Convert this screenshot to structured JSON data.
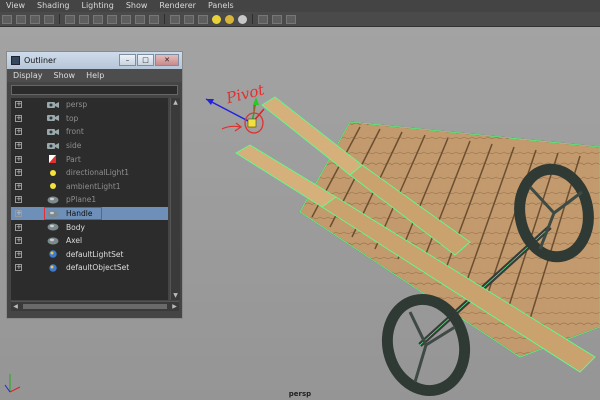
{
  "menubar": {
    "items": [
      "View",
      "Shading",
      "Lighting",
      "Show",
      "Renderer",
      "Panels"
    ]
  },
  "viewport": {
    "camera_label": "persp",
    "annotation": "Pivot"
  },
  "outliner": {
    "title": "Outliner",
    "menu": [
      "Display",
      "Show",
      "Help"
    ],
    "filter_value": "",
    "window_buttons": [
      "–",
      "□",
      "✕"
    ],
    "items": [
      {
        "label": "persp",
        "icon": "camera-icon",
        "dim": true,
        "selected": false
      },
      {
        "label": "top",
        "icon": "camera-icon",
        "dim": true,
        "selected": false
      },
      {
        "label": "front",
        "icon": "camera-icon",
        "dim": true,
        "selected": false
      },
      {
        "label": "side",
        "icon": "camera-icon",
        "dim": true,
        "selected": false
      },
      {
        "label": "Part",
        "icon": "part-icon",
        "dim": true,
        "selected": false
      },
      {
        "label": "directionalLight1",
        "icon": "light-icon",
        "dim": true,
        "selected": false
      },
      {
        "label": "ambientLight1",
        "icon": "light-icon",
        "dim": true,
        "selected": false
      },
      {
        "label": "pPlane1",
        "icon": "mesh-icon",
        "dim": true,
        "selected": false
      },
      {
        "label": "Handle",
        "icon": "mesh-icon",
        "dim": false,
        "selected": true
      },
      {
        "label": "Body",
        "icon": "mesh-icon",
        "dim": false,
        "selected": false
      },
      {
        "label": "Axel",
        "icon": "mesh-icon",
        "dim": false,
        "selected": false
      },
      {
        "label": "defaultLightSet",
        "icon": "set-icon",
        "dim": false,
        "selected": false
      },
      {
        "label": "defaultObjectSet",
        "icon": "set-icon",
        "dim": false,
        "selected": false
      }
    ]
  },
  "colors": {
    "selection": "#6d8fb8",
    "annotation_red": "#e0312f",
    "wireframe_green": "#5cff8a",
    "wood": "#c49a6c"
  }
}
